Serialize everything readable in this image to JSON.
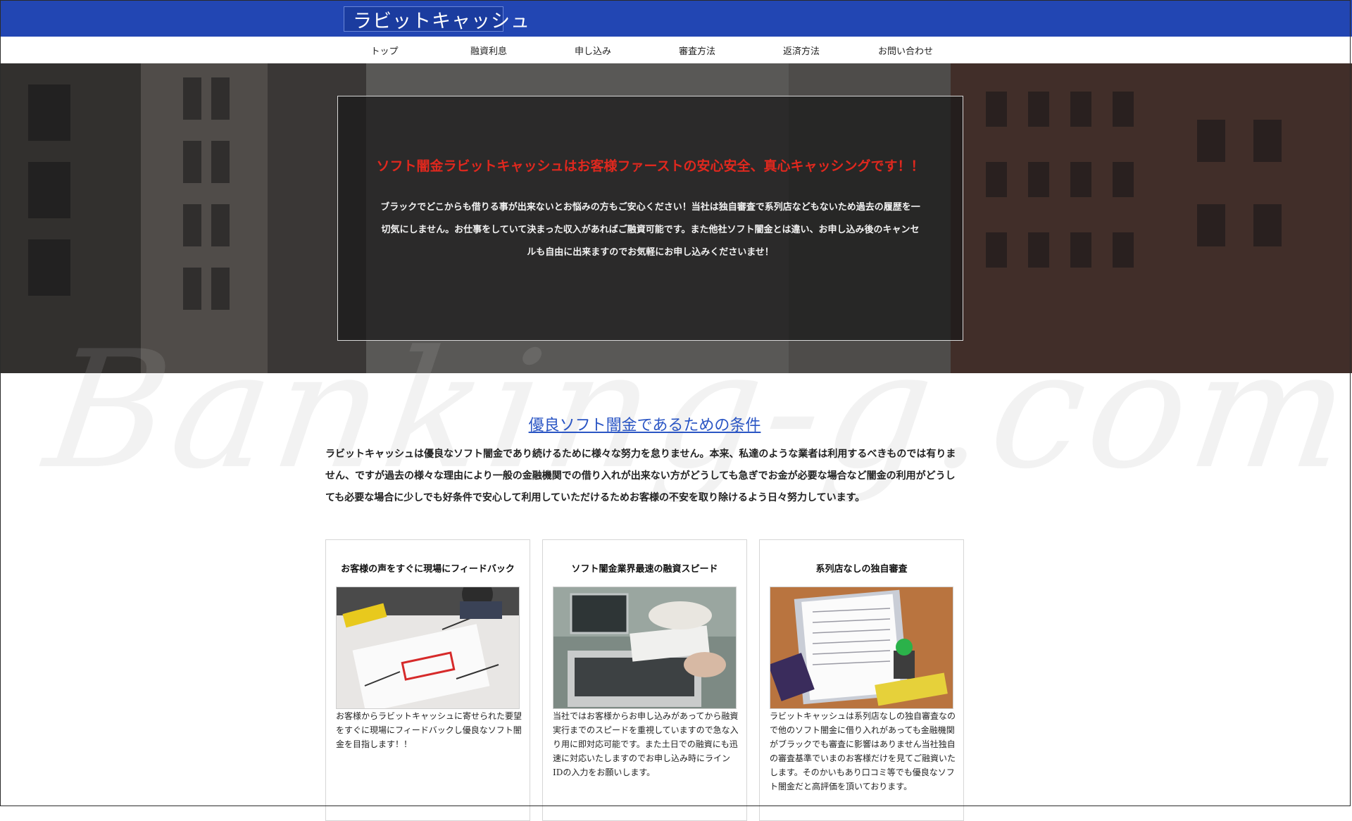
{
  "brand": {
    "logo_text": "ラビットキャッシュ",
    "logo_icon": "rabbit-icon",
    "bar_color": "#2246b3"
  },
  "nav": [
    {
      "label": "トップ"
    },
    {
      "label": "融資利息"
    },
    {
      "label": "申し込み"
    },
    {
      "label": "審査方法"
    },
    {
      "label": "返済方法"
    },
    {
      "label": "お問い合わせ"
    }
  ],
  "hero": {
    "title": "ソフト闇金ラビットキャッシュはお客様ファーストの安心安全、真心キャッシングです！！",
    "text": "ブラックでどこからも借りる事が出来ないとお悩みの方もご安心ください！当社は独自審査で系列店などもないため過去の履歴を一切気にしません。お仕事をしていて決まった収入があればご融資可能です。また他社ソフト闇金とは違い、お申し込み後のキャンセルも自由に出来ますのでお気軽にお申し込みくださいませ！",
    "title_color": "#e0281e"
  },
  "watermark": {
    "text": "Banking-g.com"
  },
  "section": {
    "title": "優良ソフト闇金であるための条件",
    "intro": "ラビットキャッシュは優良なソフト闇金であり続けるために様々な努力を怠りません。本来、私達のような業者は利用するべきものでは有りません、ですが過去の様々な理由により一般の金融機関での借り入れが出来ない方がどうしても急ぎでお金が必要な場合など闇金の利用がどうしても必要な場合に少しでも好条件で安心して利用していただけるためお客様の不安を取り除けるよう日々努力しています。"
  },
  "cards": [
    {
      "title": "お客様の声をすぐに現場にフィードバック",
      "text": "お客様からラビットキャッシュに寄せられた要望をすぐに現場にフィードバックし優良なソフト闇金を目指します！！",
      "image": "team-meeting-photo"
    },
    {
      "title": "ソフト闇金業界最速の融資スピード",
      "text": "当社ではお客様からお申し込みがあってから融資実行までのスピードを重視していますので急な入り用に即対応可能です。また土日での融資にも迅速に対応いたしますのでお申し込み時にラインIDの入力をお願いします。",
      "image": "laptop-photo"
    },
    {
      "title": "系列店なしの独自審査",
      "text": "ラビットキャッシュは系列店なしの独自審査なので他のソフト闇金に借り入れがあっても金融機関がブラックでも審査に影響はありません当社独自の審査基準でいまのお客様だけを見てご融資いたします。そのかいもあり口コミ等でも優良なソフト闇金だと高評価を頂いております。",
      "image": "clipboard-stamp-photo"
    }
  ]
}
